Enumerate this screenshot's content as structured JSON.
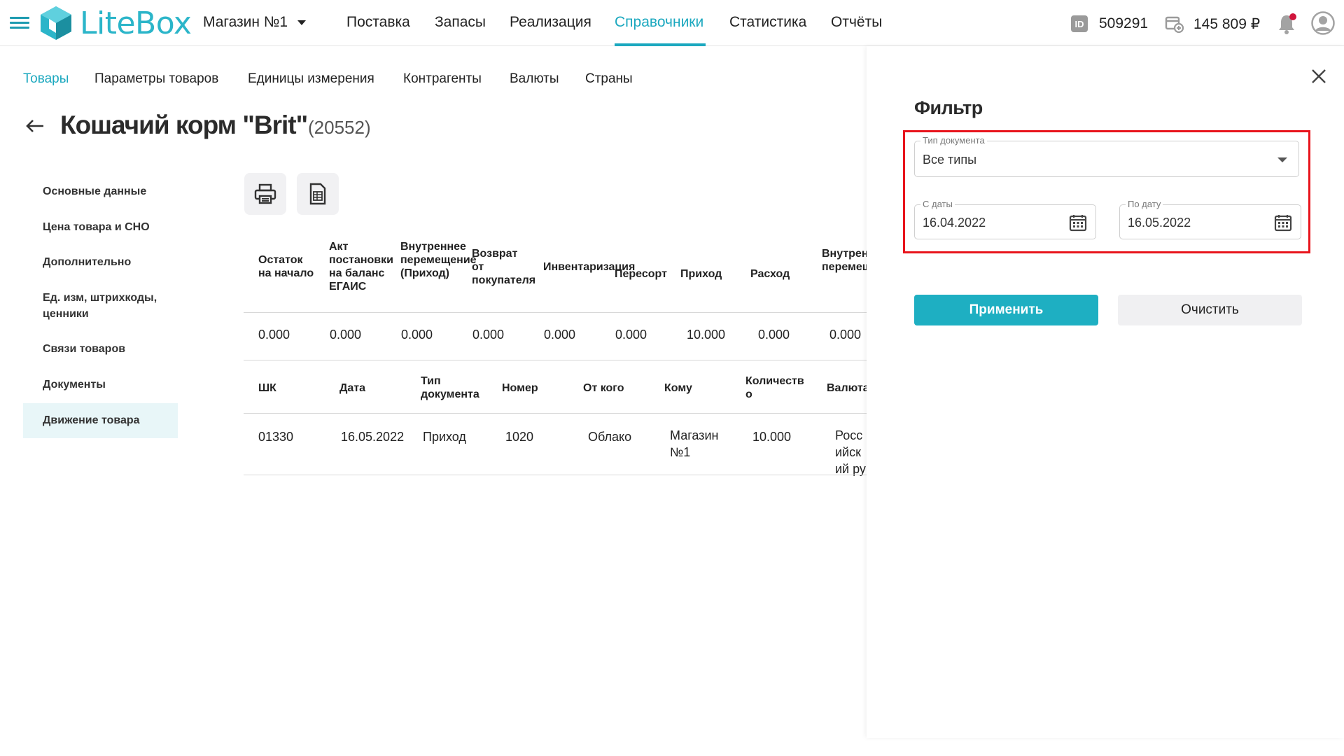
{
  "header": {
    "logo_text": "LiteBox",
    "store_name": "Магазин №1",
    "nav": [
      "Поставка",
      "Запасы",
      "Реализация",
      "Справочники",
      "Статистика",
      "Отчёты"
    ],
    "active_nav": "Справочники",
    "id_badge": "ID",
    "user_id": "509291",
    "balance": "145 809 ₽",
    "accent_color": "#1ba8bf"
  },
  "subnav": {
    "items": [
      "Товары",
      "Параметры товаров",
      "Единицы измерения",
      "Контрагенты",
      "Валюты",
      "Страны"
    ],
    "active": "Товары"
  },
  "product": {
    "title": "Кошачий корм \"Brit\"",
    "id": "(20552)"
  },
  "sidemenu": {
    "items": [
      "Основные данные",
      "Цена товара и СНО",
      "Дополнительно",
      "Ед. изм, штрихкоды, ценники",
      "Связи товаров",
      "Документы",
      "Движение товара"
    ],
    "active": "Движение товара"
  },
  "summary_table": {
    "headers": [
      "Остаток на начало",
      "Акт постановки на баланс ЕГАИС",
      "Внутреннее перемещение (Приход)",
      "Возврат от покупателя",
      "Инвентаризация",
      "Пересорт",
      "Приход",
      "Расход",
      "Внутреннее перемещение"
    ],
    "values": [
      "0.000",
      "0.000",
      "0.000",
      "0.000",
      "0.000",
      "0.000",
      "10.000",
      "0.000",
      "0.000"
    ]
  },
  "movement_table": {
    "headers": [
      "ШК",
      "Дата",
      "Тип документа",
      "Номер",
      "От кого",
      "Кому",
      "Количество",
      "Валюта"
    ],
    "rows": [
      [
        "01330",
        "16.05.2022",
        "Приход",
        "1020",
        "Облако",
        "Магазин №1",
        "10.000",
        "Российский рубль"
      ]
    ]
  },
  "filter": {
    "title": "Фильтр",
    "doc_type_label": "Тип документа",
    "doc_type_value": "Все типы",
    "date_from_label": "С даты",
    "date_from_value": "16.04.2022",
    "date_to_label": "По дату",
    "date_to_value": "16.05.2022",
    "apply_label": "Применить",
    "clear_label": "Очистить",
    "apply_color": "#1eafc2",
    "highlight_color": "#e8141c"
  }
}
